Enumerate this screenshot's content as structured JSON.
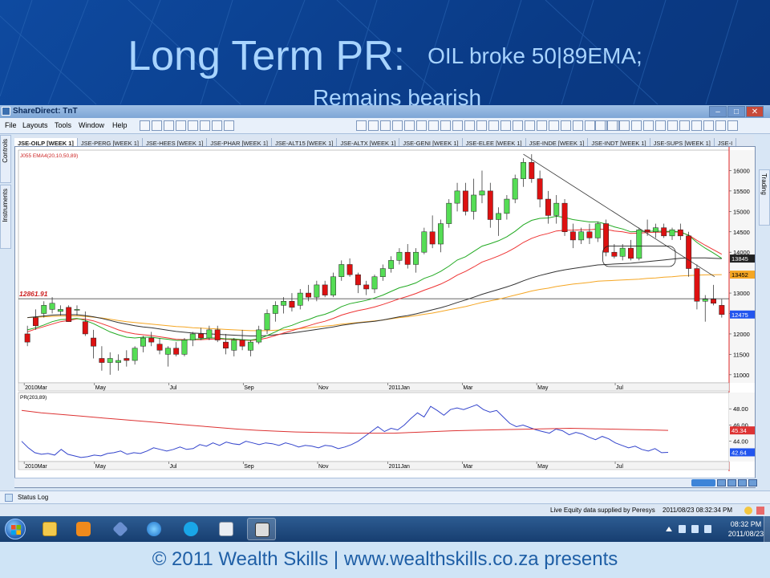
{
  "slide": {
    "title_main": "Long Term PR:",
    "title_sub": "OIL broke 50|89EMA;",
    "title_sub2": "Remains bearish",
    "footer": "© 2011 Wealth Skills | www.wealthskills.co.za presents"
  },
  "window": {
    "title": "ShareDirect: TnT",
    "min": "–",
    "max": "□",
    "close": "✕"
  },
  "menu": [
    "File",
    "Layouts",
    "Tools",
    "Window",
    "Help"
  ],
  "side_left": [
    "Controls",
    "Instruments"
  ],
  "side_right": [
    "Trading"
  ],
  "tabs": [
    "JSE-OILP [WEEK 1]",
    "JSE-PERG [WEEK 1]",
    "JSE-HEES [WEEK 1]",
    "JSE-PHAR [WEEK 1]",
    "JSE-ALT15 [WEEK 1]",
    "JSE-ALTX [WEEK 1]",
    "JSE-GENI [WEEK 1]",
    "JSE-ELEE [WEEK 1]",
    "JSE-INDE [WEEK 1]",
    "JSE-INDT [WEEK 1]",
    "JSE-SUPS [WEEK 1]",
    "JSE-I"
  ],
  "status": {
    "log": "Status Log",
    "supplier": "Live Equity data supplied by Peresys",
    "datetime": "2011/08/23 08:32:34 PM"
  },
  "taskbar": {
    "time": "08:32 PM",
    "date": "2011/08/23"
  },
  "colors": {
    "up": "#55dd55",
    "down": "#dd1111",
    "ema20": "#22aa22",
    "ema10": "#ee3333",
    "ema50": "#333333",
    "ema89": "#f5a623",
    "pr": "#3344cc",
    "pr_avg": "#dd3333"
  },
  "icons": [
    "app-icon",
    "start-orb",
    "explorer-icon",
    "media-player-icon",
    "tools-icon",
    "ie-icon",
    "skype-icon",
    "powerpoint-icon",
    "tnt-icon"
  ],
  "chart_data": [
    {
      "type": "candlestick",
      "title": "J055 EMA4(20,10,50,89)",
      "symbol": "JSE-OILP [WEEK 1]",
      "ylim": [
        10800,
        16500
      ],
      "yticks": [
        11000,
        11500,
        12000,
        12500,
        13000,
        13500,
        14000,
        14500,
        15000,
        15500,
        16000
      ],
      "x_labels": [
        "2010Mar",
        "May",
        "Jul",
        "Sep",
        "Nov",
        "2011Jan",
        "Mar",
        "May",
        "Jul"
      ],
      "horizontal_line_label": "12861.91",
      "price_tags": [
        {
          "label": "13845",
          "value": 13845,
          "color": "#222222"
        },
        {
          "label": "13452",
          "value": 13452,
          "color": "#f5a623"
        },
        {
          "label": "12475",
          "value": 12475,
          "color": "#2255ee"
        }
      ],
      "candles": [
        [
          12000,
          12200,
          11700,
          11800
        ],
        [
          12400,
          12600,
          12100,
          12200
        ],
        [
          12500,
          12800,
          12400,
          12700
        ],
        [
          12600,
          12900,
          12500,
          12750
        ],
        [
          12550,
          12700,
          12450,
          12600
        ],
        [
          12650,
          12700,
          12300,
          12300
        ],
        [
          12600,
          12700,
          12450,
          12600
        ],
        [
          12300,
          12550,
          11950,
          12000
        ],
        [
          11900,
          12100,
          11400,
          11700
        ],
        [
          11400,
          11700,
          11100,
          11300
        ],
        [
          11300,
          11550,
          11000,
          11400
        ],
        [
          11300,
          11500,
          11100,
          11350
        ],
        [
          11400,
          11600,
          11200,
          11350
        ],
        [
          11350,
          11700,
          11250,
          11650
        ],
        [
          11700,
          11950,
          11550,
          11900
        ],
        [
          11900,
          12050,
          11700,
          11800
        ],
        [
          11750,
          11900,
          11500,
          11600
        ],
        [
          11500,
          11700,
          11200,
          11650
        ],
        [
          11650,
          11800,
          11450,
          11500
        ],
        [
          11500,
          11900,
          11450,
          11850
        ],
        [
          11850,
          12050,
          11700,
          12000
        ],
        [
          12000,
          12150,
          11850,
          11900
        ],
        [
          11900,
          12200,
          11850,
          12100
        ],
        [
          12100,
          12200,
          11800,
          11850
        ],
        [
          11800,
          12000,
          11500,
          11650
        ],
        [
          11600,
          11900,
          11450,
          11850
        ],
        [
          11850,
          12100,
          11600,
          11700
        ],
        [
          11600,
          11850,
          11450,
          11800
        ],
        [
          11800,
          12200,
          11750,
          12100
        ],
        [
          12100,
          12600,
          12000,
          12500
        ],
        [
          12500,
          12800,
          12300,
          12700
        ],
        [
          12700,
          12900,
          12500,
          12800
        ],
        [
          12800,
          13000,
          12550,
          12650
        ],
        [
          12700,
          13100,
          12600,
          13000
        ],
        [
          13000,
          13200,
          12800,
          12900
        ],
        [
          12900,
          13300,
          12800,
          13200
        ],
        [
          13200,
          13300,
          12900,
          12950
        ],
        [
          12950,
          13500,
          12900,
          13400
        ],
        [
          13400,
          13800,
          13300,
          13700
        ],
        [
          13700,
          13850,
          13400,
          13450
        ],
        [
          13450,
          13500,
          13000,
          13200
        ],
        [
          13200,
          13300,
          12950,
          13100
        ],
        [
          13100,
          13450,
          13000,
          13400
        ],
        [
          13400,
          13700,
          13300,
          13600
        ],
        [
          13600,
          13900,
          13500,
          13800
        ],
        [
          13800,
          14100,
          13700,
          14000
        ],
        [
          14000,
          14200,
          13600,
          13700
        ],
        [
          13700,
          14100,
          13500,
          14000
        ],
        [
          14000,
          14600,
          13950,
          14500
        ],
        [
          14500,
          14900,
          14100,
          14200
        ],
        [
          14200,
          14800,
          14000,
          14700
        ],
        [
          14700,
          15300,
          14600,
          15200
        ],
        [
          15200,
          15700,
          15000,
          15500
        ],
        [
          15500,
          15700,
          14900,
          15000
        ],
        [
          15000,
          15800,
          14800,
          15400
        ],
        [
          15400,
          16000,
          15200,
          15500
        ],
        [
          15500,
          15700,
          14600,
          14800
        ],
        [
          14800,
          15100,
          14400,
          14950
        ],
        [
          14950,
          15400,
          14800,
          15300
        ],
        [
          15300,
          15900,
          15200,
          15800
        ],
        [
          15800,
          16300,
          15600,
          16200
        ],
        [
          16200,
          16400,
          15700,
          15800
        ],
        [
          15800,
          16000,
          15100,
          15300
        ],
        [
          15300,
          15500,
          14700,
          14900
        ],
        [
          14900,
          15400,
          14700,
          15200
        ],
        [
          15200,
          15300,
          14400,
          14500
        ],
        [
          14500,
          14700,
          14100,
          14300
        ],
        [
          14300,
          14600,
          14200,
          14500
        ],
        [
          14500,
          14700,
          14200,
          14350
        ],
        [
          14350,
          14750,
          14250,
          14700
        ],
        [
          14700,
          14800,
          13900,
          14000
        ],
        [
          14000,
          14200,
          13850,
          13900
        ],
        [
          13900,
          14200,
          13800,
          14100
        ],
        [
          14100,
          14300,
          13800,
          13850
        ],
        [
          13850,
          14600,
          13800,
          14550
        ],
        [
          14550,
          14800,
          14400,
          14500
        ],
        [
          14500,
          14700,
          14350,
          14600
        ],
        [
          14600,
          14700,
          14350,
          14400
        ],
        [
          14400,
          14600,
          14300,
          14550
        ],
        [
          14550,
          14700,
          14300,
          14400
        ],
        [
          14400,
          14500,
          13400,
          13600
        ],
        [
          13600,
          13700,
          12600,
          12800
        ],
        [
          12800,
          12950,
          12300,
          12850
        ],
        [
          12850,
          13200,
          12700,
          12750
        ],
        [
          12700,
          12850,
          12400,
          12475
        ]
      ],
      "ema20": [
        12100,
        12150,
        12220,
        12300,
        12350,
        12360,
        12380,
        12330,
        12250,
        12150,
        12050,
        11980,
        11920,
        11900,
        11920,
        11920,
        11890,
        11870,
        11840,
        11850,
        11870,
        11880,
        11900,
        11900,
        11880,
        11880,
        11860,
        11850,
        11880,
        11960,
        12050,
        12150,
        12210,
        12290,
        12350,
        12430,
        12480,
        12560,
        12670,
        12740,
        12780,
        12820,
        12880,
        12950,
        13040,
        13130,
        13180,
        13250,
        13360,
        13430,
        13530,
        13660,
        13810,
        13890,
        14020,
        14150,
        14210,
        14280,
        14380,
        14510,
        14670,
        14780,
        14830,
        14840,
        14880,
        14850,
        14800,
        14770,
        14740,
        14740,
        14690,
        14620,
        14570,
        14500,
        14510,
        14510,
        14520,
        14510,
        14510,
        14500,
        14410,
        14240,
        14100,
        13980,
        13850
      ],
      "ema10": [
        12050,
        12120,
        12180,
        12240,
        12300,
        12330,
        12370,
        12360,
        12320,
        12250,
        12180,
        12100,
        12040,
        12000,
        11980,
        11960,
        11930,
        11900,
        11870,
        11860,
        11860,
        11860,
        11870,
        11880,
        11870,
        11860,
        11850,
        11840,
        11860,
        11900,
        11960,
        12020,
        12080,
        12140,
        12200,
        12260,
        12310,
        12380,
        12460,
        12520,
        12570,
        12610,
        12660,
        12720,
        12790,
        12860,
        12920,
        12990,
        13070,
        13140,
        13220,
        13320,
        13440,
        13530,
        13640,
        13760,
        13830,
        13910,
        14000,
        14110,
        14240,
        14340,
        14410,
        14460,
        14520,
        14540,
        14540,
        14550,
        14550,
        14570,
        14560,
        14520,
        14500,
        14460,
        14470,
        14480,
        14490,
        14490,
        14500,
        14490,
        14420,
        14290,
        14170,
        14060,
        13950
      ],
      "ema50": [
        12400,
        12420,
        12440,
        12460,
        12470,
        12470,
        12470,
        12450,
        12420,
        12380,
        12330,
        12280,
        12240,
        12200,
        12170,
        12150,
        12120,
        12090,
        12060,
        12040,
        12020,
        12010,
        12000,
        11990,
        11980,
        11970,
        11960,
        11950,
        11950,
        11960,
        11980,
        12000,
        12020,
        12050,
        12080,
        12110,
        12140,
        12170,
        12210,
        12240,
        12270,
        12290,
        12310,
        12340,
        12380,
        12420,
        12450,
        12490,
        12540,
        12590,
        12640,
        12700,
        12770,
        12830,
        12900,
        12970,
        13030,
        13090,
        13150,
        13220,
        13300,
        13370,
        13430,
        13480,
        13530,
        13570,
        13600,
        13630,
        13660,
        13690,
        13700,
        13710,
        13720,
        13730,
        13750,
        13770,
        13790,
        13810,
        13830,
        13850,
        13860,
        13860,
        13860,
        13850,
        13845
      ],
      "ema89": [
        12400,
        12410,
        12420,
        12430,
        12440,
        12440,
        12440,
        12430,
        12410,
        12390,
        12360,
        12330,
        12300,
        12280,
        12260,
        12240,
        12220,
        12200,
        12180,
        12170,
        12150,
        12140,
        12130,
        12120,
        12110,
        12100,
        12090,
        12080,
        12080,
        12080,
        12090,
        12100,
        12110,
        12130,
        12150,
        12170,
        12190,
        12210,
        12240,
        12260,
        12280,
        12300,
        12320,
        12340,
        12370,
        12400,
        12420,
        12450,
        12480,
        12510,
        12550,
        12590,
        12630,
        12670,
        12720,
        12770,
        12810,
        12850,
        12900,
        12950,
        13000,
        13050,
        13090,
        13120,
        13160,
        13190,
        13220,
        13240,
        13260,
        13290,
        13300,
        13310,
        13320,
        13330,
        13340,
        13360,
        13370,
        13390,
        13400,
        13420,
        13430,
        13440,
        13445,
        13450,
        13452
      ]
    },
    {
      "type": "line",
      "title": "PR(203,89)",
      "ylim": [
        41.5,
        50
      ],
      "yticks": [
        44.0,
        46.0,
        48.0
      ],
      "price_tags": [
        {
          "label": "45.34",
          "value": 45.34,
          "color": "#dd3333"
        },
        {
          "label": "42.64",
          "value": 42.64,
          "color": "#2255ee"
        }
      ],
      "series": [
        {
          "values": [
            44.0,
            43.2,
            42.6,
            42.4,
            42.5,
            42.3,
            43.0,
            42.4,
            42.2,
            42.0,
            42.1,
            42.3,
            42.2,
            42.5,
            42.6,
            42.8,
            42.4,
            42.6,
            42.5,
            42.8,
            43.2,
            43.0,
            42.8,
            43.0,
            43.3,
            43.0,
            43.1,
            43.6,
            43.4,
            43.8,
            43.5,
            43.9,
            43.7,
            43.6,
            44.0,
            43.8,
            43.6,
            43.8,
            43.7,
            43.5,
            43.8,
            43.6,
            43.3,
            43.5,
            43.4,
            43.2,
            43.5,
            43.4,
            43.1,
            43.3,
            43.6,
            44.0,
            44.6,
            45.2,
            45.8,
            45.2,
            45.6,
            45.4,
            46.0,
            46.8,
            47.5,
            47.0,
            48.3,
            47.8,
            47.2,
            47.9,
            48.1,
            47.9,
            48.2,
            48.5,
            47.9,
            47.6,
            47.8,
            47.0,
            46.2,
            45.8,
            46.0,
            45.7,
            45.4,
            45.2,
            45.0,
            45.5,
            45.3,
            44.8,
            45.1,
            44.9,
            44.5,
            44.2,
            44.6,
            44.3,
            43.8,
            43.5,
            43.2,
            43.4,
            43.0,
            42.8,
            43.1,
            42.6,
            42.64
          ]
        },
        {
          "values": [
            47.8,
            47.5,
            47.3,
            47.1,
            46.9,
            46.7,
            46.5,
            46.3,
            46.1,
            45.9,
            45.7,
            45.5,
            45.35,
            45.25,
            45.15,
            45.1,
            45.05,
            45.0,
            45.0,
            45.0,
            45.1,
            45.2,
            45.3,
            45.35,
            45.4,
            45.45,
            45.5,
            45.55,
            45.6,
            45.55,
            45.5,
            45.45,
            45.4,
            45.34
          ]
        }
      ]
    }
  ]
}
